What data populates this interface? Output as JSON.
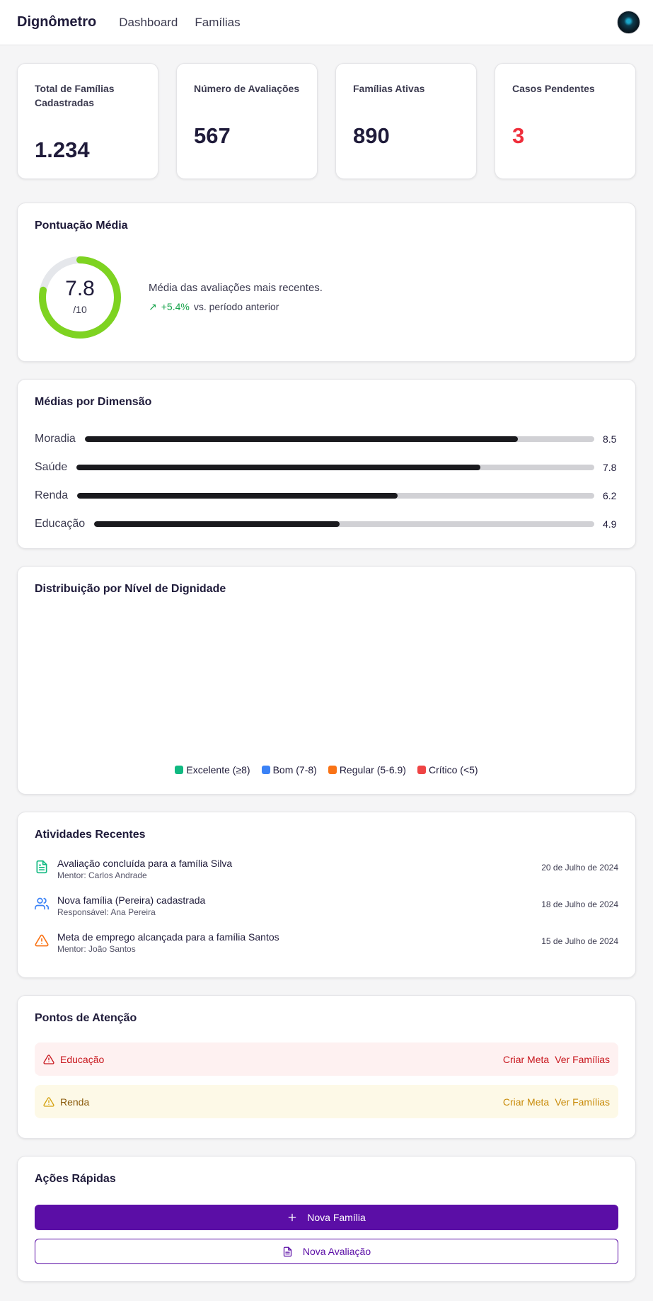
{
  "header": {
    "brand": "Dignômetro",
    "nav": [
      "Dashboard",
      "Famílias"
    ]
  },
  "stats": [
    {
      "label": "Total de Famílias Cadastradas",
      "value": "1.234"
    },
    {
      "label": "Número de Avaliações",
      "value": "567"
    },
    {
      "label": "Famílias Ativas",
      "value": "890"
    },
    {
      "label": "Casos Pendentes",
      "value": "3"
    }
  ],
  "score": {
    "title": "Pontuação Média",
    "value": "7.8",
    "max": "/10",
    "fraction": 0.78,
    "description": "Média das avaliações mais recentes.",
    "trend": "+5.4%",
    "trend_suffix": "vs. período anterior",
    "color": "#7ed321"
  },
  "dimensions": {
    "title": "Médias por Dimensão",
    "items": [
      {
        "label": "Moradia",
        "value": "8.5"
      },
      {
        "label": "Saúde",
        "value": "7.8"
      },
      {
        "label": "Renda",
        "value": "6.2"
      },
      {
        "label": "Educação",
        "value": "4.9"
      }
    ]
  },
  "distribution": {
    "title": "Distribuição por Nível de Dignidade",
    "legend": [
      {
        "label": "Excelente (≥8)",
        "color": "#10b981"
      },
      {
        "label": "Bom (7-8)",
        "color": "#3b82f6"
      },
      {
        "label": "Regular (5-6.9)",
        "color": "#f97316"
      },
      {
        "label": "Crítico (<5)",
        "color": "#ef4444"
      }
    ]
  },
  "activities": {
    "title": "Atividades Recentes",
    "items": [
      {
        "title": "Avaliação concluída para a família Silva",
        "sub": "Mentor: Carlos Andrade",
        "date": "20 de Julho de 2024",
        "icon": "document-icon"
      },
      {
        "title": "Nova família (Pereira) cadastrada",
        "sub": "Responsável: Ana Pereira",
        "date": "18 de Julho de 2024",
        "icon": "users-icon"
      },
      {
        "title": "Meta de emprego alcançada para a família Santos",
        "sub": "Mentor: João Santos",
        "date": "15 de Julho de 2024",
        "icon": "warning-icon"
      }
    ]
  },
  "attention": {
    "title": "Pontos de Atenção",
    "items": [
      {
        "label": "Educação",
        "create": "Criar Meta",
        "view": "Ver Famílias"
      },
      {
        "label": "Renda",
        "create": "Criar Meta",
        "view": "Ver Famílias"
      }
    ]
  },
  "quick_actions": {
    "title": "Ações Rápidas",
    "new_family": "Nova Família",
    "new_evaluation": "Nova Avaliação"
  }
}
